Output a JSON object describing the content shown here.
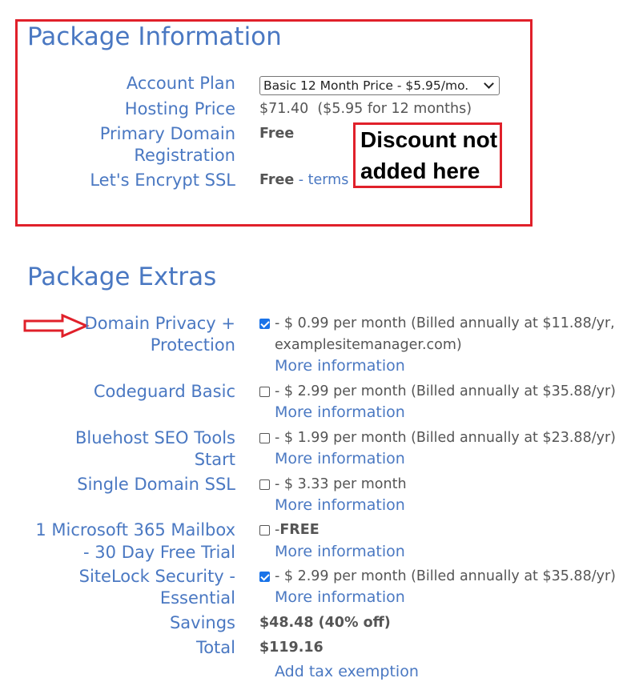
{
  "package_information": {
    "title": "Package Information",
    "account_plan": {
      "label": "Account Plan",
      "selected": "Basic 12 Month Price - $5.95/mo."
    },
    "hosting_price": {
      "label": "Hosting Price",
      "value": "$71.40  ($5.95 for 12 months)"
    },
    "primary_domain": {
      "label_line1": "Primary Domain",
      "label_line2": "Registration",
      "value": "Free"
    },
    "ssl": {
      "label": "Let's Encrypt SSL",
      "value": "Free",
      "sep": " - ",
      "terms": "terms"
    }
  },
  "annotation": {
    "line1": "Discount not",
    "line2": "added here"
  },
  "package_extras": {
    "title": "Package Extras",
    "more_info": "More information",
    "items": [
      {
        "label_line1": "Domain Privacy +",
        "label_line2": "Protection",
        "checked": true,
        "text": "- $ 0.99 per month (Billed annually at $11.88/yr,",
        "text2": "examplesitemanager.com)"
      },
      {
        "label_line1": "Codeguard Basic",
        "checked": false,
        "text": "- $ 2.99 per month (Billed annually at $35.88/yr)"
      },
      {
        "label_line1": "Bluehost SEO Tools",
        "label_line2": "Start",
        "checked": false,
        "text": "- $ 1.99 per month (Billed annually at $23.88/yr)"
      },
      {
        "label_line1": "Single Domain SSL",
        "checked": false,
        "text": "- $ 3.33 per month"
      },
      {
        "label_line1": "1 Microsoft 365 Mailbox",
        "label_line2": "- 30 Day Free Trial",
        "checked": false,
        "text_prefix": "-",
        "text_bold": "FREE"
      },
      {
        "label_line1": "SiteLock Security -",
        "label_line2": "Essential",
        "checked": true,
        "text": "- $ 2.99 per month (Billed annually at $35.88/yr)"
      }
    ],
    "savings": {
      "label": "Savings",
      "value": "$48.48 (40% off)"
    },
    "total": {
      "label": "Total",
      "value": "$119.16"
    },
    "tax_link": "Add tax exemption"
  }
}
